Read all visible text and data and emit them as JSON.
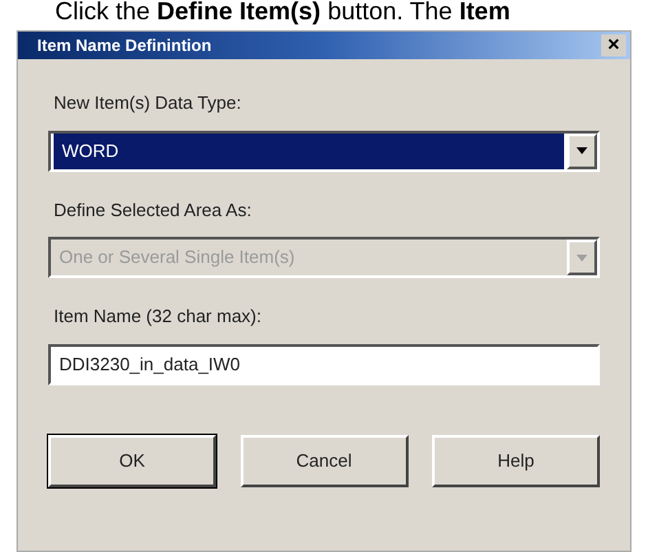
{
  "caption": "Click the **Define Item(s)** button. The **Item**",
  "window": {
    "title": "Item Name Definintion",
    "close": "×"
  },
  "fields": [
    {
      "kind": "select",
      "label": "New Item(s) Data Type:",
      "value": "WORD",
      "focused": true,
      "disabled": false
    },
    {
      "kind": "select",
      "label": "Define Selected Area As:",
      "value": "One or Several Single Item(s)",
      "focused": false,
      "disabled": true
    },
    {
      "kind": "text",
      "label": "Item Name (32 char max):",
      "value": "DDI3230_in_data_IW0"
    }
  ],
  "buttons": [
    {
      "label": "OK",
      "default": true
    },
    {
      "label": "Cancel",
      "default": false
    },
    {
      "label": "Help",
      "default": false
    }
  ]
}
